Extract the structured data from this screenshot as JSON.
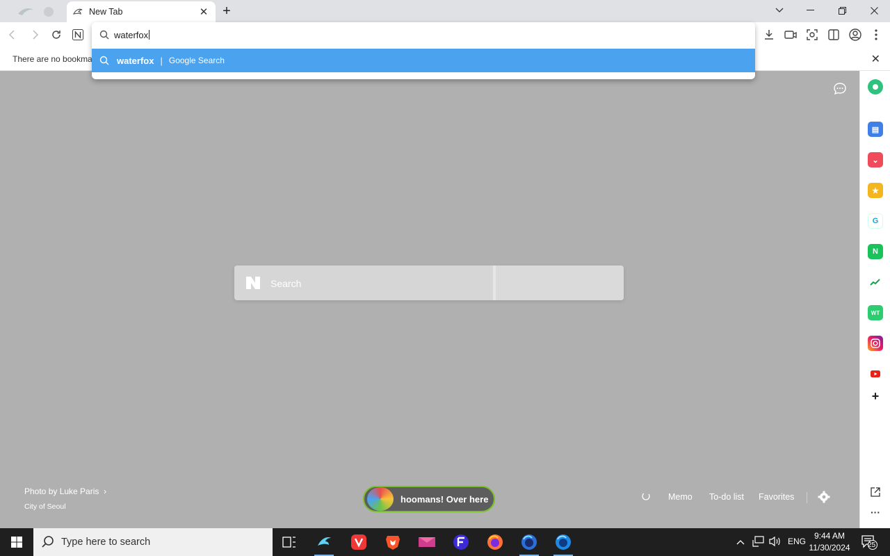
{
  "browser": {
    "tab": {
      "title": "New Tab"
    },
    "bookmarks_bar": {
      "message": "There are no bookmarks"
    },
    "omnibox": {
      "value": "waterfox",
      "suggestion": {
        "query": "waterfox",
        "separator": "|",
        "engine": "Google Search"
      }
    }
  },
  "newtab": {
    "search": {
      "placeholder": "Search"
    },
    "photo_credit": {
      "line1": "Photo by Luke Paris",
      "line2": "City of Seoul"
    },
    "promo": {
      "text": "hoomans! Over here"
    },
    "links": {
      "memo": "Memo",
      "todo": "To-do list",
      "favorites": "Favorites"
    }
  },
  "sidebar": {
    "icons": [
      "whale-ai-icon",
      "wallet-icon",
      "pocket-icon",
      "bookmark-star-icon",
      "translate-icon",
      "naver-store-icon",
      "stock-chart-icon",
      "webtoon-icon",
      "instagram-icon",
      "youtube-icon",
      "add-icon"
    ]
  },
  "taskbar": {
    "search_placeholder": "Type here to search",
    "language": "ENG",
    "time": "9:44 AM",
    "date": "11/30/2024",
    "notification_count": "25"
  },
  "colors": {
    "accent": "#4ba3ef",
    "page_bg": "#b0b0b0",
    "promo_border": "#7bbf2a",
    "taskbar": "#1f1f1f"
  }
}
